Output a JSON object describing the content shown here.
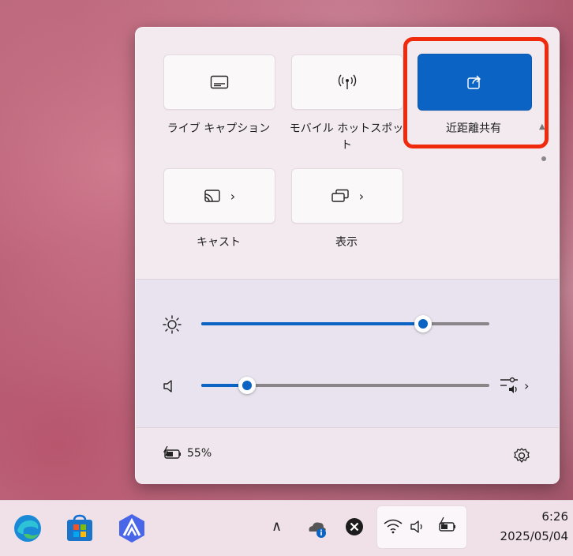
{
  "quick_settings": {
    "tiles": [
      {
        "label": "ライブ キャプション",
        "icon": "live-caption-icon",
        "active": false
      },
      {
        "label": "モバイル ホットスポット",
        "icon": "mobile-hotspot-icon",
        "active": false
      },
      {
        "label": "近距離共有",
        "icon": "nearby-share-icon",
        "active": true
      },
      {
        "label": "キャスト",
        "icon": "cast-icon",
        "active": false,
        "has_chevron": true
      },
      {
        "label": "表示",
        "icon": "project-display-icon",
        "active": false,
        "has_chevron": true
      }
    ],
    "brightness": {
      "icon": "brightness-icon",
      "value_fraction": 0.77
    },
    "volume": {
      "icon": "speaker-icon",
      "value_fraction": 0.16,
      "mixer_icon": "volume-mixer-icon"
    },
    "battery": {
      "icon": "battery-charging-icon",
      "percent_text": "55%"
    },
    "settings_icon": "gear-icon"
  },
  "taskbar": {
    "apps": [
      "edge-icon",
      "microsoft-store-icon",
      "app-a-icon"
    ],
    "tray": [
      "chevron-up-icon",
      "onedrive-icon",
      "close-circle-icon"
    ],
    "tray_box": [
      "wifi-icon",
      "speaker-icon",
      "battery-charging-icon"
    ],
    "time": "6:26",
    "date": "2025/05/04"
  },
  "colors": {
    "accent": "#0b63c4",
    "highlight": "#f02a0c"
  }
}
